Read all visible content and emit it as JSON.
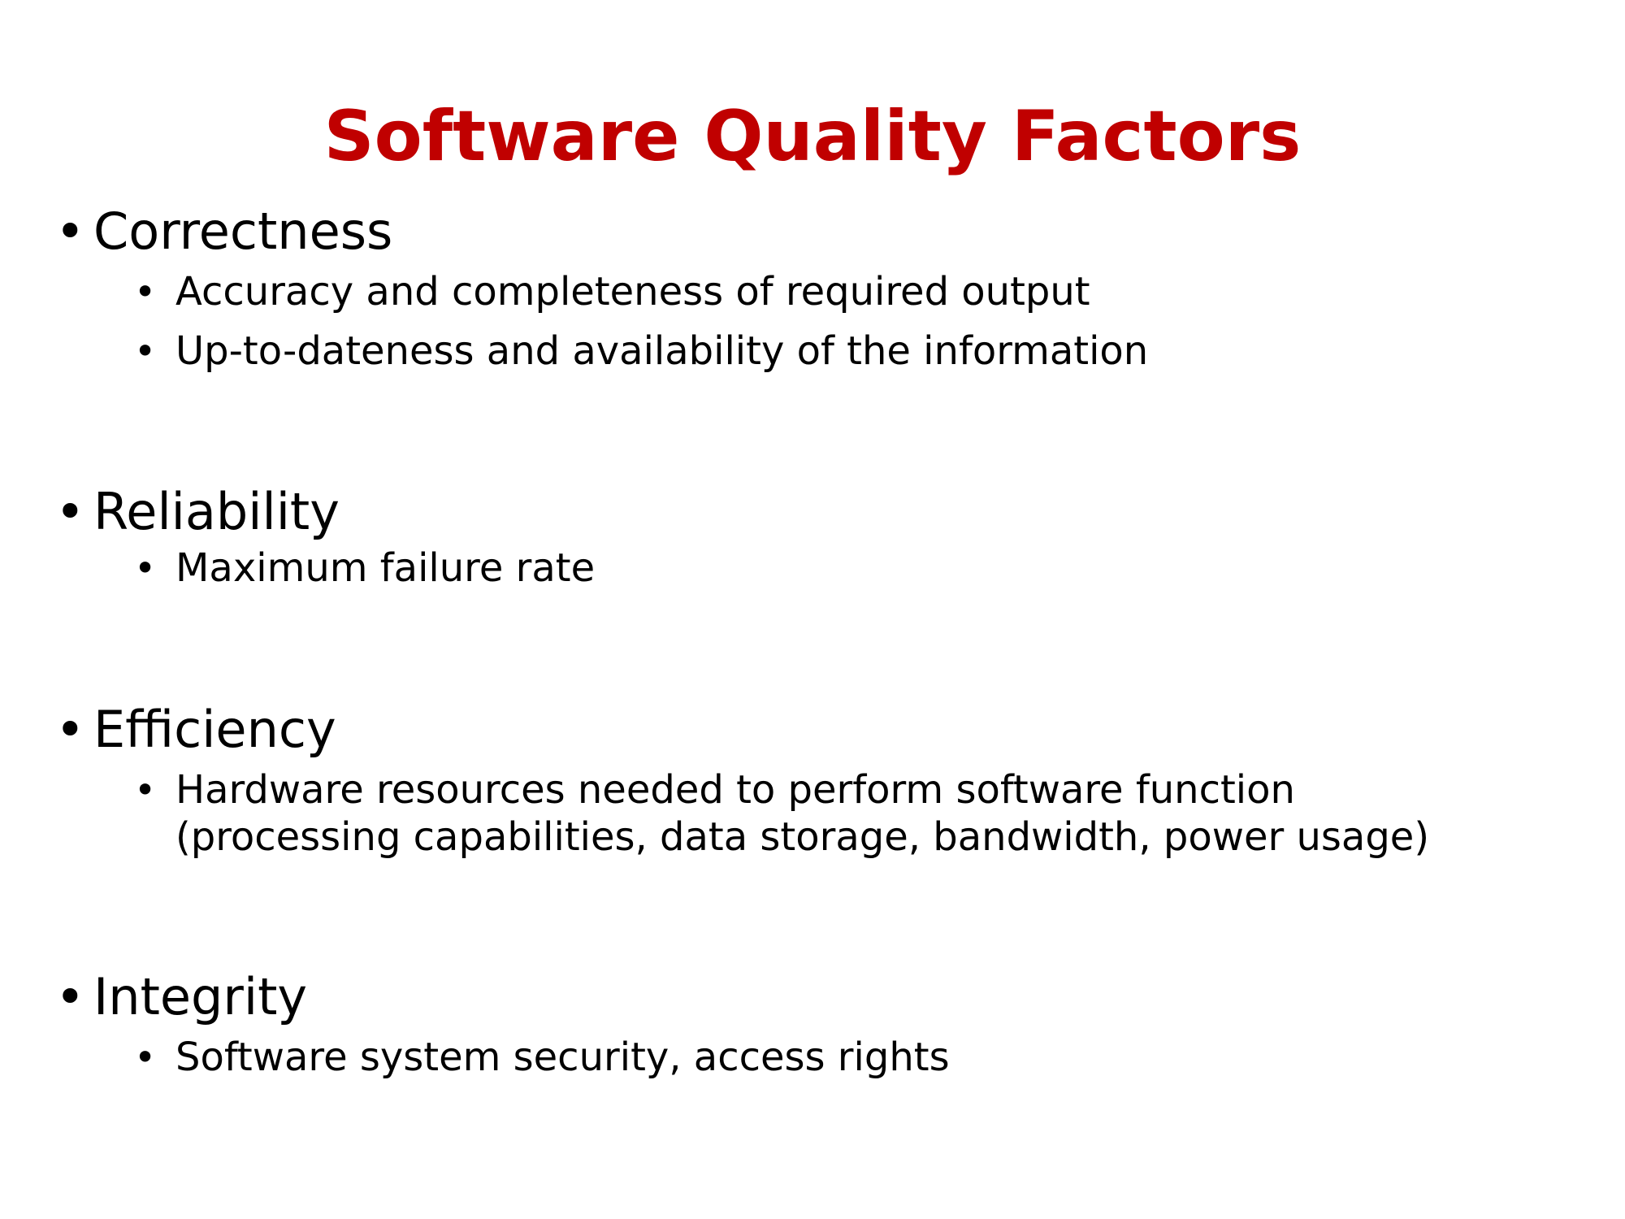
{
  "title": "Software Quality Factors",
  "colors": {
    "title": "#c00000",
    "text": "#000000",
    "background": "#ffffff"
  },
  "bullet_glyph": "•",
  "items": [
    {
      "heading": "Correctness",
      "subitems": [
        "Accuracy and completeness of required output",
        "Up-to-dateness and availability of the information"
      ]
    },
    {
      "heading": "Reliability",
      "subitems": [
        "Maximum failure rate"
      ]
    },
    {
      "heading": "Efficiency",
      "subitems": [
        "Hardware resources needed to perform software function (processing capabilities, data storage, bandwidth, power usage)"
      ]
    },
    {
      "heading": "Integrity",
      "subitems": [
        "Software system security, access rights"
      ]
    }
  ]
}
